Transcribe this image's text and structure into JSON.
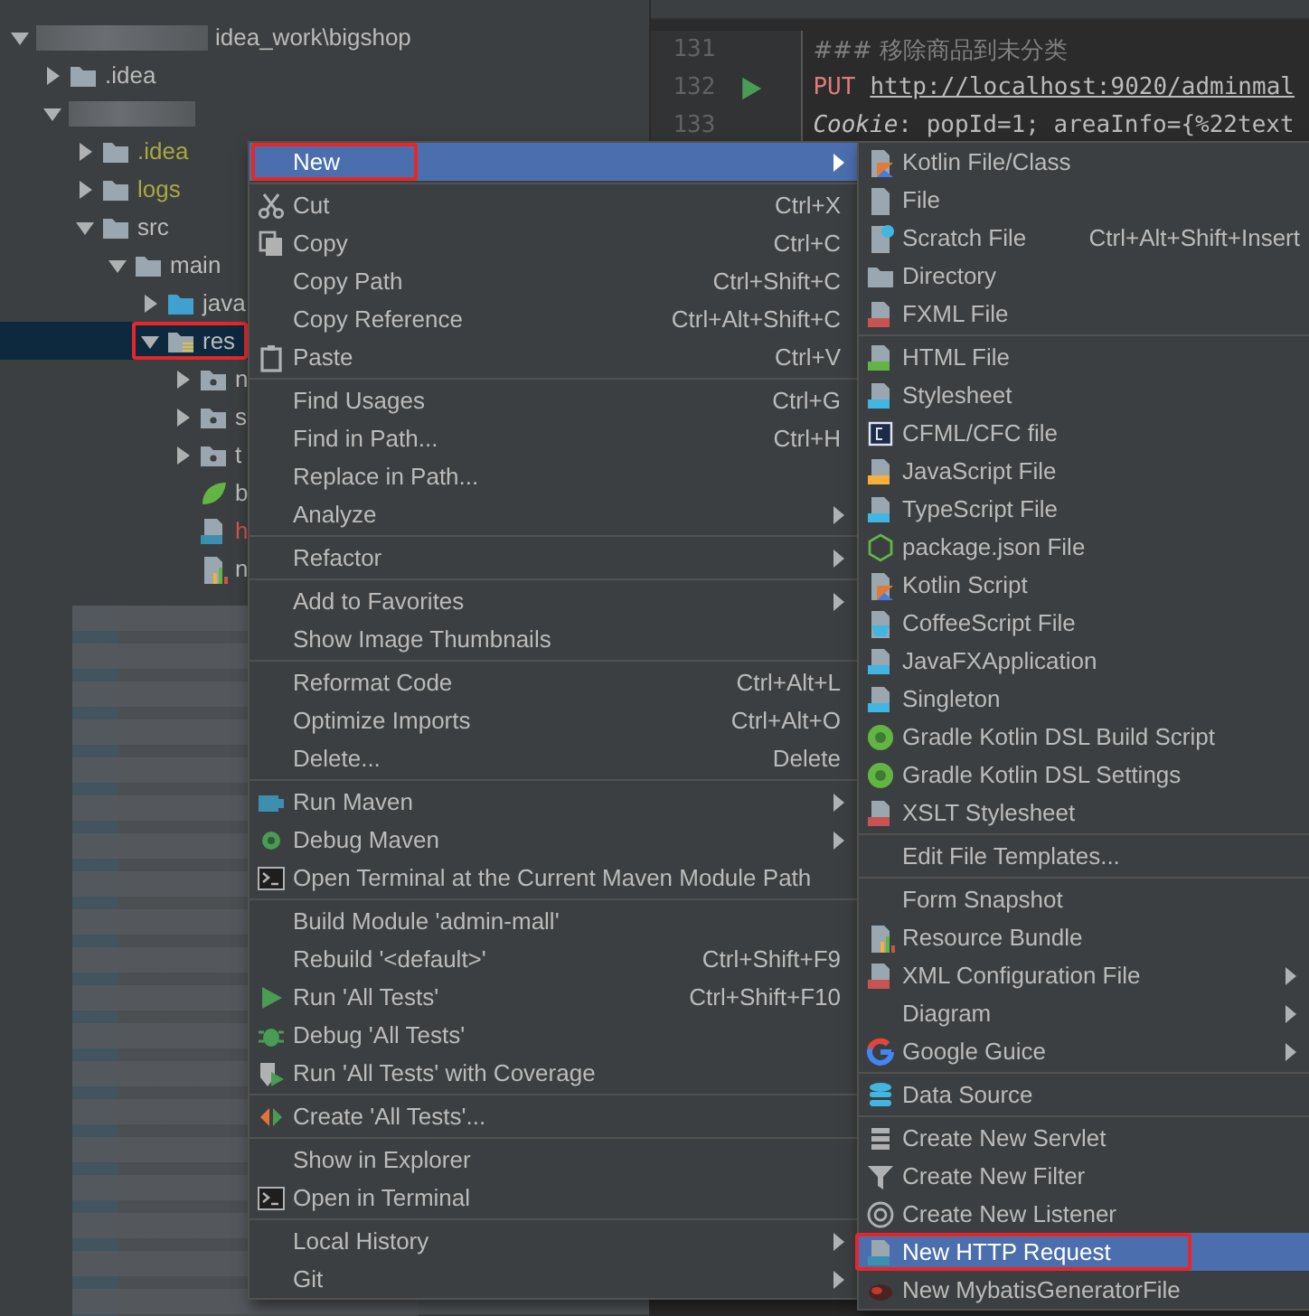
{
  "project_tree": {
    "nodes": [
      {
        "kind": "project",
        "label": "idea_work\\bigshop",
        "expanded": true,
        "selected": false,
        "children": [
          {
            "kind": "folder",
            "label": ".idea",
            "expanded": false,
            "selected": false
          },
          {
            "kind": "blurred-module",
            "expanded": true,
            "selected": false,
            "children": [
              {
                "kind": "folder",
                "label": ".idea",
                "expanded": false,
                "selected": false,
                "ignored": true
              },
              {
                "kind": "folder",
                "label": "logs",
                "expanded": false,
                "selected": false,
                "ignored": true
              },
              {
                "kind": "folder",
                "label": "src",
                "expanded": true,
                "selected": false,
                "children": [
                  {
                    "kind": "folder",
                    "label": "main",
                    "expanded": true,
                    "selected": false,
                    "children": [
                      {
                        "kind": "source-folder",
                        "label": "java",
                        "expanded": false,
                        "selected": false
                      },
                      {
                        "kind": "resource-folder",
                        "label": "res",
                        "expanded": true,
                        "selected": true,
                        "highlighted": true,
                        "children": [
                          {
                            "kind": "package",
                            "label": "n",
                            "expanded": false,
                            "selected": false
                          },
                          {
                            "kind": "package",
                            "label": "s",
                            "expanded": false,
                            "selected": false
                          },
                          {
                            "kind": "package",
                            "label": "t",
                            "expanded": false,
                            "selected": false
                          },
                          {
                            "kind": "file-spring",
                            "label": "b",
                            "selected": false
                          },
                          {
                            "kind": "file-api",
                            "label": "h",
                            "selected": false,
                            "has_error": true
                          },
                          {
                            "kind": "file-chart",
                            "label": "n",
                            "selected": false
                          }
                        ]
                      }
                    ]
                  }
                ]
              }
            ]
          }
        ]
      }
    ]
  },
  "editor": {
    "lines": [
      {
        "number": "131",
        "kind": "comment",
        "text": "### 移除商品到未分类"
      },
      {
        "number": "132",
        "kind": "request",
        "method": "PUT",
        "url": "http://localhost:9020/adminmal",
        "run": true
      },
      {
        "number": "133",
        "kind": "header",
        "name": "Cookie",
        "value": ": popId=1; areaInfo={%22text"
      }
    ]
  },
  "context_menu": {
    "sections": [
      [
        {
          "label": "New",
          "submenu": true,
          "selected": true,
          "highlighted": true
        }
      ],
      [
        {
          "label": "Cut",
          "shortcut": "Ctrl+X",
          "selected": false
        },
        {
          "label": "Copy",
          "shortcut": "Ctrl+C",
          "selected": false
        },
        {
          "label": "Copy Path",
          "shortcut": "Ctrl+Shift+C",
          "selected": false
        },
        {
          "label": "Copy Reference",
          "shortcut": "Ctrl+Alt+Shift+C",
          "selected": false
        },
        {
          "label": "Paste",
          "shortcut": "Ctrl+V",
          "selected": false
        }
      ],
      [
        {
          "label": "Find Usages",
          "shortcut": "Ctrl+G",
          "selected": false
        },
        {
          "label": "Find in Path...",
          "shortcut": "Ctrl+H",
          "selected": false
        },
        {
          "label": "Replace in Path...",
          "selected": false
        },
        {
          "label": "Analyze",
          "submenu": true,
          "selected": false
        }
      ],
      [
        {
          "label": "Refactor",
          "submenu": true,
          "selected": false
        }
      ],
      [
        {
          "label": "Add to Favorites",
          "submenu": true,
          "selected": false
        },
        {
          "label": "Show Image Thumbnails",
          "selected": false
        }
      ],
      [
        {
          "label": "Reformat Code",
          "shortcut": "Ctrl+Alt+L",
          "selected": false
        },
        {
          "label": "Optimize Imports",
          "shortcut": "Ctrl+Alt+O",
          "selected": false
        },
        {
          "label": "Delete...",
          "shortcut": "Delete",
          "selected": false
        }
      ],
      [
        {
          "label": "Run Maven",
          "submenu": true,
          "selected": false
        },
        {
          "label": "Debug Maven",
          "submenu": true,
          "selected": false
        },
        {
          "label": "Open Terminal at the Current Maven Module Path",
          "selected": false
        }
      ],
      [
        {
          "label": "Build Module 'admin-mall'",
          "selected": false
        },
        {
          "label": "Rebuild '<default>'",
          "shortcut": "Ctrl+Shift+F9",
          "selected": false
        },
        {
          "label": "Run 'All Tests'",
          "shortcut": "Ctrl+Shift+F10",
          "selected": false
        },
        {
          "label": "Debug 'All Tests'",
          "selected": false
        },
        {
          "label": "Run 'All Tests' with Coverage",
          "selected": false
        }
      ],
      [
        {
          "label": "Create 'All Tests'...",
          "selected": false
        }
      ],
      [
        {
          "label": "Show in Explorer",
          "selected": false
        },
        {
          "label": "Open in Terminal",
          "selected": false
        }
      ],
      [
        {
          "label": "Local History",
          "submenu": true,
          "selected": false
        },
        {
          "label": "Git",
          "submenu": true,
          "selected": false
        }
      ]
    ]
  },
  "new_submenu": {
    "sections": [
      [
        {
          "label": "Kotlin File/Class",
          "selected": false
        },
        {
          "label": "File",
          "selected": false
        },
        {
          "label": "Scratch File",
          "shortcut": "Ctrl+Alt+Shift+Insert",
          "selected": false
        },
        {
          "label": "Directory",
          "selected": false
        },
        {
          "label": "FXML File",
          "selected": false
        }
      ],
      [
        {
          "label": "HTML File",
          "selected": false
        },
        {
          "label": "Stylesheet",
          "selected": false
        },
        {
          "label": "CFML/CFC file",
          "selected": false
        },
        {
          "label": "JavaScript File",
          "selected": false
        },
        {
          "label": "TypeScript File",
          "selected": false
        },
        {
          "label": "package.json File",
          "selected": false
        },
        {
          "label": "Kotlin Script",
          "selected": false
        },
        {
          "label": "CoffeeScript File",
          "selected": false
        },
        {
          "label": "JavaFXApplication",
          "selected": false
        },
        {
          "label": "Singleton",
          "selected": false
        },
        {
          "label": "Gradle Kotlin DSL Build Script",
          "selected": false
        },
        {
          "label": "Gradle Kotlin DSL Settings",
          "selected": false
        },
        {
          "label": "XSLT Stylesheet",
          "selected": false
        }
      ],
      [
        {
          "label": "Edit File Templates...",
          "selected": false
        }
      ],
      [
        {
          "label": "Form Snapshot",
          "selected": false
        },
        {
          "label": "Resource Bundle",
          "selected": false
        },
        {
          "label": "XML Configuration File",
          "submenu": true,
          "selected": false
        },
        {
          "label": "Diagram",
          "submenu": true,
          "selected": false
        },
        {
          "label": "Google Guice",
          "submenu": true,
          "selected": false
        }
      ],
      [
        {
          "label": "Data Source",
          "selected": false
        }
      ],
      [
        {
          "label": "Create New Servlet",
          "selected": false
        },
        {
          "label": "Create New Filter",
          "selected": false
        },
        {
          "label": "Create New Listener",
          "selected": false
        },
        {
          "label": "New HTTP Request",
          "selected": true,
          "highlighted": true
        },
        {
          "label": "New MybatisGeneratorFile",
          "selected": false
        }
      ]
    ]
  }
}
